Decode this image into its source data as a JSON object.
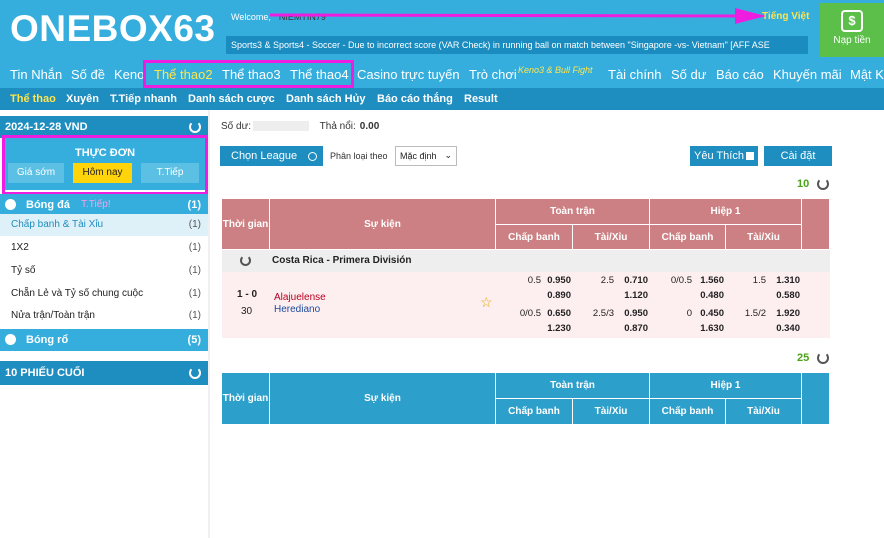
{
  "header": {
    "logo": "ONEBOX63",
    "welcome": "Welcome,",
    "username": "NIEMTIN79",
    "language": "Tiếng Việt",
    "marquee": "Sports3 & Sports4 - Soccer - Due to incorrect score (VAR Check) in running ball on match between \"Singapore -vs- Vietnam\" [AFF ASE",
    "deposit": "Nạp tiền"
  },
  "top_nav": [
    "Tin Nhắn",
    "Số đề",
    "Keno",
    "Thể thao2",
    "Thể thao3",
    "Thể thao4",
    "Casino trực tuyến",
    "Trò chơi",
    "Keno3 & Bull Fight",
    "Tài chính",
    "Số dư",
    "Báo cáo",
    "Khuyến mãi",
    "Mật K"
  ],
  "sub_nav": [
    "Thể thao",
    "Xuyên",
    "T.Tiếp nhanh",
    "Danh sách cược",
    "Danh sách Hủy",
    "Báo cáo thắng",
    "Result"
  ],
  "sidebar": {
    "date": "2024-12-28 VND",
    "menu_title": "THỰC ĐƠN",
    "menu_buttons": [
      "Giá sớm",
      "Hôm nay",
      "T.Tiếp"
    ],
    "football": {
      "label": "Bóng đá",
      "tiep": "T.Tiếp!",
      "count": "(1)"
    },
    "items": [
      {
        "label": "Chấp banh & Tài Xỉu",
        "count": "(1)"
      },
      {
        "label": "1X2",
        "count": "(1)"
      },
      {
        "label": "Tỷ số",
        "count": "(1)"
      },
      {
        "label": "Chẵn Lẻ và Tỷ số chung cuộc",
        "count": "(1)"
      },
      {
        "label": "Nửa trận/Toàn trận",
        "count": "(1)"
      }
    ],
    "basketball": {
      "label": "Bóng rổ",
      "count": "(5)"
    },
    "last10": "10 PHIẾU CUỐI"
  },
  "main": {
    "balance_label": "Số dư:",
    "outstanding_label": "Thả nổi:",
    "outstanding_value": "0.00",
    "choose_league": "Chọn League",
    "sort_label": "Phân loại theo",
    "sort_value": "Mặc định",
    "favorite": "Yêu Thích",
    "settings": "Cài đặt",
    "count1": "10",
    "count2": "25"
  },
  "table_headers": {
    "time": "Thời gian",
    "event": "Sự kiện",
    "full": "Toàn trận",
    "half": "Hiệp 1",
    "hdp": "Chấp banh",
    "ou": "Tài/Xỉu"
  },
  "league": "Costa Rica - Primera División",
  "match": {
    "score": "1 - 0",
    "minute": "30",
    "home": "Alajuelense",
    "away": "Herediano",
    "row1": [
      "0.5",
      "0.950",
      "2.5",
      "0.710",
      "0/0.5",
      "1.560",
      "1.5",
      "1.310"
    ],
    "row1b": [
      "0.890",
      "1.120",
      "0.480",
      "0.580"
    ],
    "row2": [
      "0/0.5",
      "0.650",
      "2.5/3",
      "0.950",
      "0",
      "0.450",
      "1.5/2",
      "1.920"
    ],
    "row2b": [
      "1.230",
      "0.870",
      "1.630",
      "0.340"
    ]
  },
  "colors": {
    "brand": "#35aede",
    "dark": "#1e8dbf",
    "highlight": "#ee1ee0",
    "header_red": "#cd8083"
  }
}
